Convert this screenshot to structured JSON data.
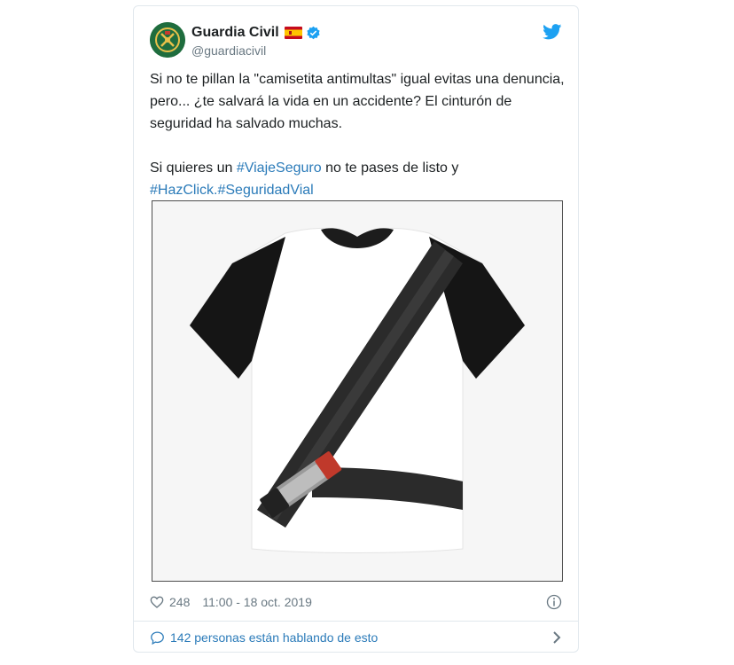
{
  "tweet": {
    "author_name": "Guardia Civil",
    "author_handle": "@guardiacivil",
    "text_line1": "Si no te pillan la \"camisetita antimultas\" igual evitas una denuncia, pero... ¿te salvará la vida en un accidente? El cinturón de seguridad ha salvado muchas.",
    "text2_pre": "Si quieres un ",
    "hashtag1": "#ViajeSeguro",
    "text2_mid": " no te pases de listo y ",
    "hashtag2": "#HazClick",
    "text2_dot": ".",
    "hashtag3": "#SeguridadVial",
    "likes": "248",
    "timestamp": "11:00 - 18 oct. 2019",
    "conversation": "142 personas están hablando de esto"
  },
  "icons": {
    "avatar": "guardia-civil-emblem",
    "flag": "spain-flag-icon",
    "verified": "verified-badge-icon",
    "brand": "twitter-bird-icon",
    "like": "heart-icon",
    "info": "info-icon",
    "conversation": "speech-bubble-icon",
    "more": "chevron-right-icon"
  },
  "colors": {
    "link": "#2b7bb9",
    "secondary_text": "#697882",
    "twitter_blue": "#1da1f2",
    "border": "#e1e8ed"
  }
}
